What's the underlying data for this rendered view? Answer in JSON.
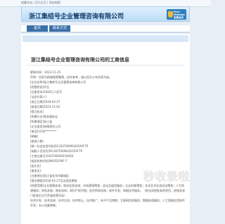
{
  "topbar": {
    "links": "收藏本站 | 设为主页 | 网站地图"
  },
  "header": {
    "site_title": "浙江集结号企业管理咨询有限公司",
    "badge": {
      "icon": "shield-icon",
      "text": "Free Member 免费会员"
    }
  },
  "nav": {
    "items": [
      {
        "label": "首页"
      },
      {
        "label": "联系方式"
      }
    ]
  },
  "page": {
    "title": "浙江集结号企业管理咨询有限公司的工商信息",
    "lines": [
      "更新时间：2023-11-25",
      "声明：信息为网络搜索整理，仅作参考，请以官方公布信息为准。",
      "[企业名称]浙江集结号企业管理咨询有限公司",
      "[经营状态]开业",
      "[注册资本]1000万人民币",
      "[法定代表人]",
      "[成立日期]2018-03-27",
      "[核准日期]2023-11-02",
      "[登记机关]",
      "[所属行业]商务服务业",
      "[所属地区]浙江省",
      "[企业类型]有限责任公司",
      "[电话]1356********",
      "[邮箱]",
      "[参保人数]",
      "[统一社会信用代码]91330700MA2D1P4F7P",
      "[纳税人识别号]91330700MA2D1P4F7P",
      "[工商注册号]330700000254040",
      "[组织机构代码]MA2D1P4F-7",
      "[英文名]",
      "[曾用名]",
      "[注册地址]浙江省金华市婺城区",
      "[营业期限]2018-03-27至无固定期限",
      "[经营范围]企业管理咨询；商务信息咨询；市场营销策划；会议及展览服务；企业形象策划；文化艺术交流活动策划；人力资源服务；财务咨询；税务咨询；知识产权代理；经济贸易咨询；软件开发；网络技术服务。（依法须经批准的项目，经相关部门批准后方可开展经营活动）",
      "技术开发、技术咨询、技术交流、技术转让、技术推广；电子产品销售；互联网信息服务；数据处理服务；人工智能应用软件开发；办公设备销售。"
    ]
  },
  "watermark": "秒收录啦"
}
